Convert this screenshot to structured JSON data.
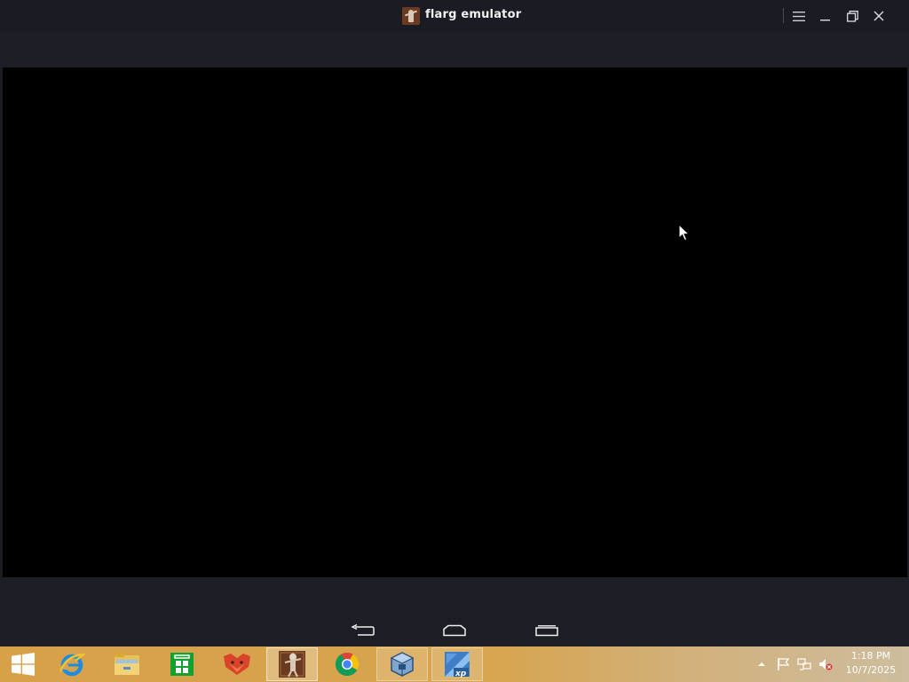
{
  "window": {
    "title": "flarg emulator"
  },
  "taskbar": {
    "items": [
      {
        "name": "Internet Explorer",
        "icon": "internet-explorer-icon"
      },
      {
        "name": "File Explorer",
        "icon": "file-explorer-icon"
      },
      {
        "name": "Store",
        "icon": "store-icon"
      },
      {
        "name": "Fox app",
        "icon": "fox-icon"
      },
      {
        "name": "flarg emulator",
        "icon": "flarg-emulator-icon",
        "state": "active"
      },
      {
        "name": "Google Chrome",
        "icon": "chrome-icon"
      },
      {
        "name": "VirtualBox",
        "icon": "virtualbox-icon",
        "state": "open"
      },
      {
        "name": "XP Mode",
        "icon": "xp-mode-icon",
        "state": "open"
      }
    ],
    "clock": {
      "time": "1:18 PM",
      "date": "10/7/2025"
    }
  },
  "colors": {
    "title_bar": "#1a1b23",
    "screen": "#000000",
    "taskbar": "#d9a04a"
  }
}
